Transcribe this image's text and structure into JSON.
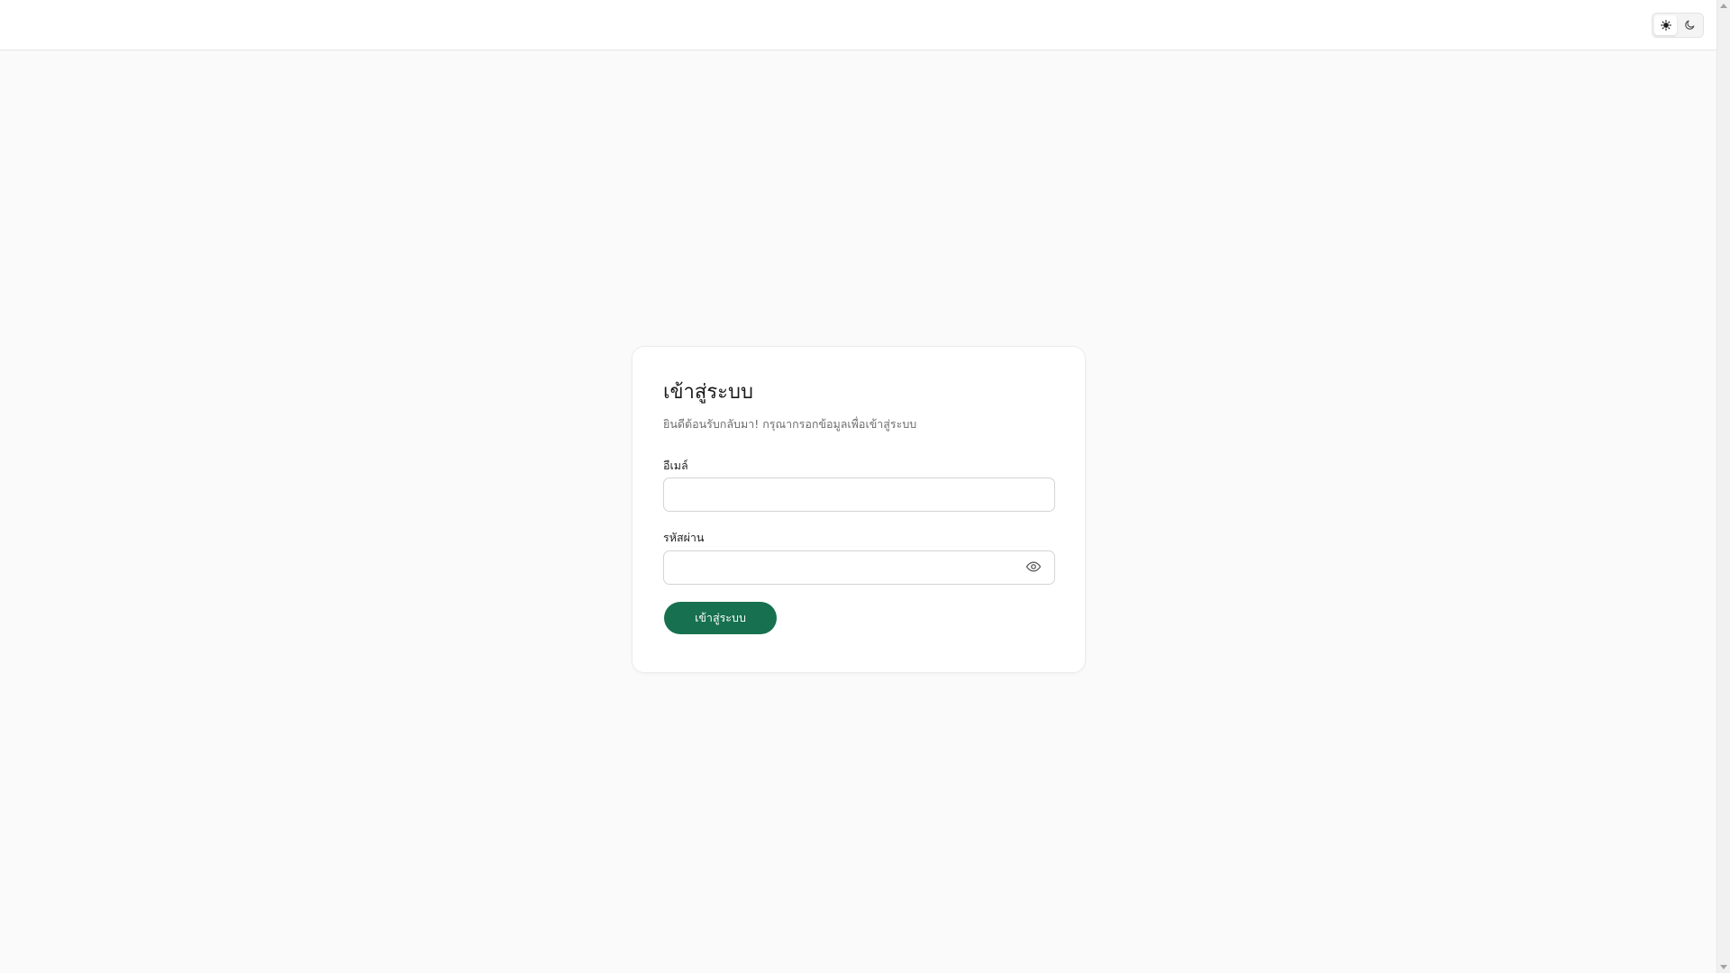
{
  "header": {
    "theme_toggle": {
      "options": [
        {
          "name": "light",
          "icon": "sun-icon",
          "active": true
        },
        {
          "name": "dark",
          "icon": "moon-icon",
          "active": false
        }
      ]
    }
  },
  "login": {
    "title": "เข้าสู่ระบบ",
    "subtitle": "ยินดีต้อนรับกลับมา! กรุณากรอกข้อมูลเพื่อเข้าสู่ระบบ",
    "email_label": "อีเมล์",
    "email_value": "",
    "email_placeholder": "",
    "password_label": "รหัสผ่าน",
    "password_value": "",
    "password_placeholder": "",
    "password_toggle_icon": "eye-icon",
    "submit_label": "เข้าสู่ระบบ"
  },
  "colors": {
    "primary": "#17704f",
    "background": "#fafafa",
    "card": "#ffffff",
    "border": "#d4d4d4"
  }
}
